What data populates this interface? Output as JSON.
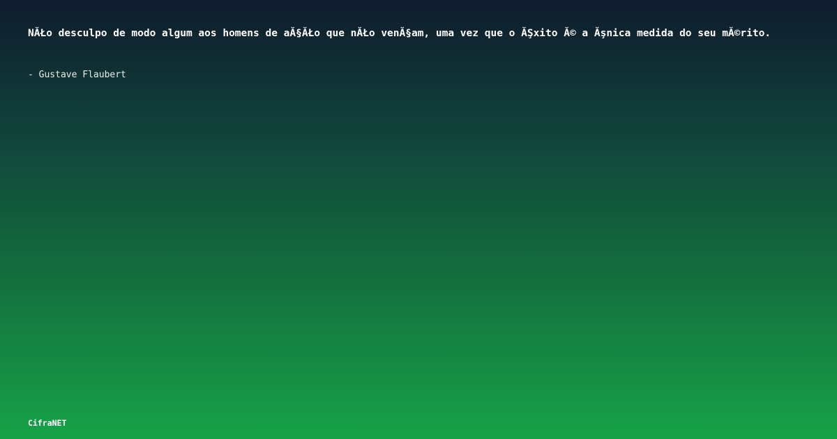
{
  "quote": {
    "text": "NĂŁo desculpo de modo algum aos homens de aĂ§ĂŁo que nĂŁo venĂ§am, uma vez que o ĂŞxito Ă© a Ăşnica medida do seu mĂ©rito.",
    "author": "- Gustave Flaubert"
  },
  "footer": {
    "brand": "CifraNET"
  },
  "colors": {
    "gradient_top": "#0f1b2d",
    "gradient_bottom": "#17a248",
    "text": "#ffffff"
  }
}
